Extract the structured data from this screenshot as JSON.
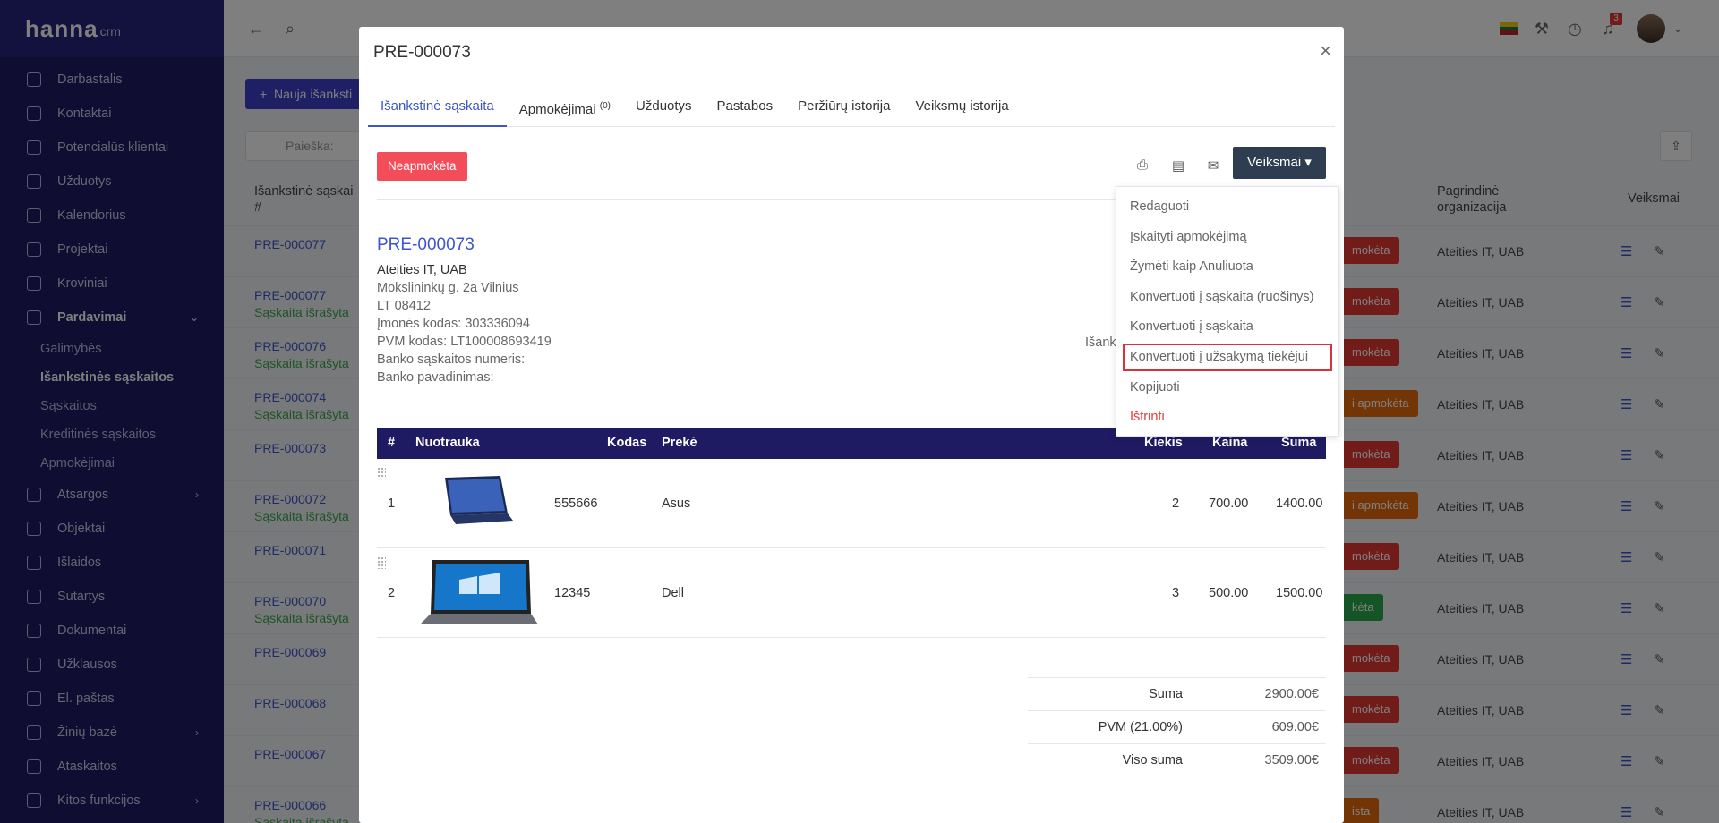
{
  "app": {
    "logo_main": "hanna",
    "logo_sub": "crm"
  },
  "sidebar": {
    "items": [
      {
        "label": "Darbastalis"
      },
      {
        "label": "Kontaktai"
      },
      {
        "label": "Potencialūs klientai"
      },
      {
        "label": "Užduotys"
      },
      {
        "label": "Kalendorius"
      },
      {
        "label": "Projektai"
      },
      {
        "label": "Kroviniai"
      },
      {
        "label": "Pardavimai"
      },
      {
        "label": "Atsargos"
      },
      {
        "label": "Objektai"
      },
      {
        "label": "Išlaidos"
      },
      {
        "label": "Sutartys"
      },
      {
        "label": "Dokumentai"
      },
      {
        "label": "Užklausos"
      },
      {
        "label": "El. paštas"
      },
      {
        "label": "Žinių bazė"
      },
      {
        "label": "Ataskaitos"
      },
      {
        "label": "Kitos funkcijos"
      }
    ],
    "sub_items": [
      {
        "label": "Galimybės"
      },
      {
        "label": "Išankstinės sąskaitos"
      },
      {
        "label": "Sąskaitos"
      },
      {
        "label": "Kreditinės sąskaitos"
      },
      {
        "label": "Apmokėjimai"
      }
    ]
  },
  "topbar": {
    "notifications_count": "3"
  },
  "list": {
    "new_button": "Nauja išanksti",
    "search_placeholder": "Paieška:",
    "col_invoice": "Išankstinė sąskai",
    "col_invoice_hash": "#",
    "col_org": "Pagrindinė",
    "col_org2": "organizacija",
    "col_actions": "Veiksmai",
    "rows": [
      {
        "id": "PRE-000077",
        "sub": "",
        "org": "Ateities IT, UAB",
        "status": "mokėta",
        "status_color": "#e53935"
      },
      {
        "id": "PRE-000077",
        "sub": "Sąskaita išrašyta",
        "org": "Ateities IT, UAB",
        "status": "mokėta",
        "status_color": "#e53935"
      },
      {
        "id": "PRE-000076",
        "sub": "Sąskaita išrašyta",
        "org": "Ateities IT, UAB",
        "status": "mokėta",
        "status_color": "#e53935"
      },
      {
        "id": "PRE-000074",
        "sub": "Sąskaita išrašyta",
        "org": "Ateities IT, UAB",
        "status": "i apmokėta",
        "status_color": "#e86a0c"
      },
      {
        "id": "PRE-000073",
        "sub": "",
        "org": "Ateities IT, UAB",
        "status": "mokėta",
        "status_color": "#e53935"
      },
      {
        "id": "PRE-000072",
        "sub": "Sąskaita išrašyta",
        "org": "Ateities IT, UAB",
        "status": "i apmokėta",
        "status_color": "#e86a0c"
      },
      {
        "id": "PRE-000071",
        "sub": "",
        "org": "Ateities IT, UAB",
        "status": "mokėta",
        "status_color": "#e53935"
      },
      {
        "id": "PRE-000070",
        "sub": "Sąskaita išrašyta",
        "org": "Ateities IT, UAB",
        "status": "kėta",
        "status_color": "#2aa84a"
      },
      {
        "id": "PRE-000069",
        "sub": "",
        "org": "Ateities IT, UAB",
        "status": "mokėta",
        "status_color": "#e53935"
      },
      {
        "id": "PRE-000068",
        "sub": "",
        "org": "Ateities IT, UAB",
        "status": "mokėta",
        "status_color": "#e53935"
      },
      {
        "id": "PRE-000067",
        "sub": "",
        "org": "Ateities IT, UAB",
        "status": "mokėta",
        "status_color": "#e53935"
      },
      {
        "id": "PRE-000066",
        "sub": "Sąskaita išrašyta",
        "org": "Ateities IT, UAB",
        "status": "ista",
        "status_color": "#e86a0c"
      }
    ]
  },
  "modal": {
    "title": "PRE-000073",
    "tabs": [
      {
        "label": "Išankstinė sąskaita"
      },
      {
        "label": "Apmokėjimai",
        "sup": "(0)"
      },
      {
        "label": "Užduotys"
      },
      {
        "label": "Pastabos"
      },
      {
        "label": "Peržiūrų istorija"
      },
      {
        "label": "Veiksmų istorija"
      }
    ],
    "status": "Neapmokėta",
    "actions_label": "Veiksmai",
    "doc_id": "PRE-000073",
    "company": "Ateities IT, UAB",
    "address": [
      "Mokslininkų g. 2a Vilnius",
      "LT 08412",
      "Įmonės kodas: 303336094",
      "PVM kodas: LT100008693419",
      "Banko sąskaitos numeris:",
      "Banko pavadinimas:"
    ],
    "right_label": "Išank",
    "items_header": {
      "num": "#",
      "image": "Nuotrauka",
      "code": "Kodas",
      "product": "Prekė",
      "qty": "Kiekis",
      "price": "Kaina",
      "sum": "Suma"
    },
    "items": [
      {
        "num": "1",
        "code": "555666",
        "product": "Asus",
        "qty": "2",
        "price": "700.00",
        "sum": "1400.00"
      },
      {
        "num": "2",
        "code": "12345",
        "product": "Dell",
        "qty": "3",
        "price": "500.00",
        "sum": "1500.00"
      }
    ],
    "totals": [
      {
        "label": "Suma",
        "value": "2900.00€"
      },
      {
        "label": "PVM (21.00%)",
        "value": "609.00€"
      },
      {
        "label": "Viso suma",
        "value": "3509.00€"
      }
    ],
    "dropdown": [
      {
        "label": "Redaguoti"
      },
      {
        "label": "Įskaityti apmokėjimą"
      },
      {
        "label": "Žymėti kaip Anuliuota"
      },
      {
        "label": "Konvertuoti į sąskaita (ruošinys)"
      },
      {
        "label": "Konvertuoti į sąskaita"
      },
      {
        "label": "Konvertuoti į užsakymą tiekėjui"
      },
      {
        "label": "Kopijuoti"
      },
      {
        "label": "Ištrinti"
      }
    ]
  }
}
